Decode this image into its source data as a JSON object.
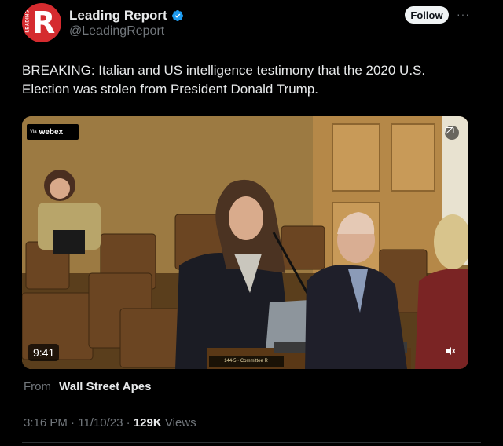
{
  "author": {
    "display_name": "Leading Report",
    "handle": "@LeadingReport",
    "avatar_letter": "R",
    "avatar_side_text": "LEADING",
    "verified": true,
    "verified_icon": "verified-badge-icon"
  },
  "header": {
    "follow_label": "Follow",
    "more_icon": "more-dots-icon",
    "more_glyph": "···"
  },
  "tweet": {
    "text": "BREAKING: Italian and US intelligence testimony that the 2020 U.S. Election was stolen from President Donald Trump."
  },
  "media": {
    "badge_via": "Via",
    "badge_brand": "webex",
    "timer": "9:41",
    "placard": "144-5 · Committee R",
    "gif_icon": "gif-icon",
    "volume_icon": "volume-icon"
  },
  "source": {
    "label": "From",
    "name": "Wall Street Apes"
  },
  "meta": {
    "time": "3:16 PM",
    "date": "11/10/23",
    "views": "129K",
    "views_label": "Views",
    "separator": "·"
  },
  "colors": {
    "background": "#000000",
    "text": "#e7e9ea",
    "muted": "#71767b",
    "verified": "#1d9bf0",
    "avatar": "#d52b2f"
  }
}
